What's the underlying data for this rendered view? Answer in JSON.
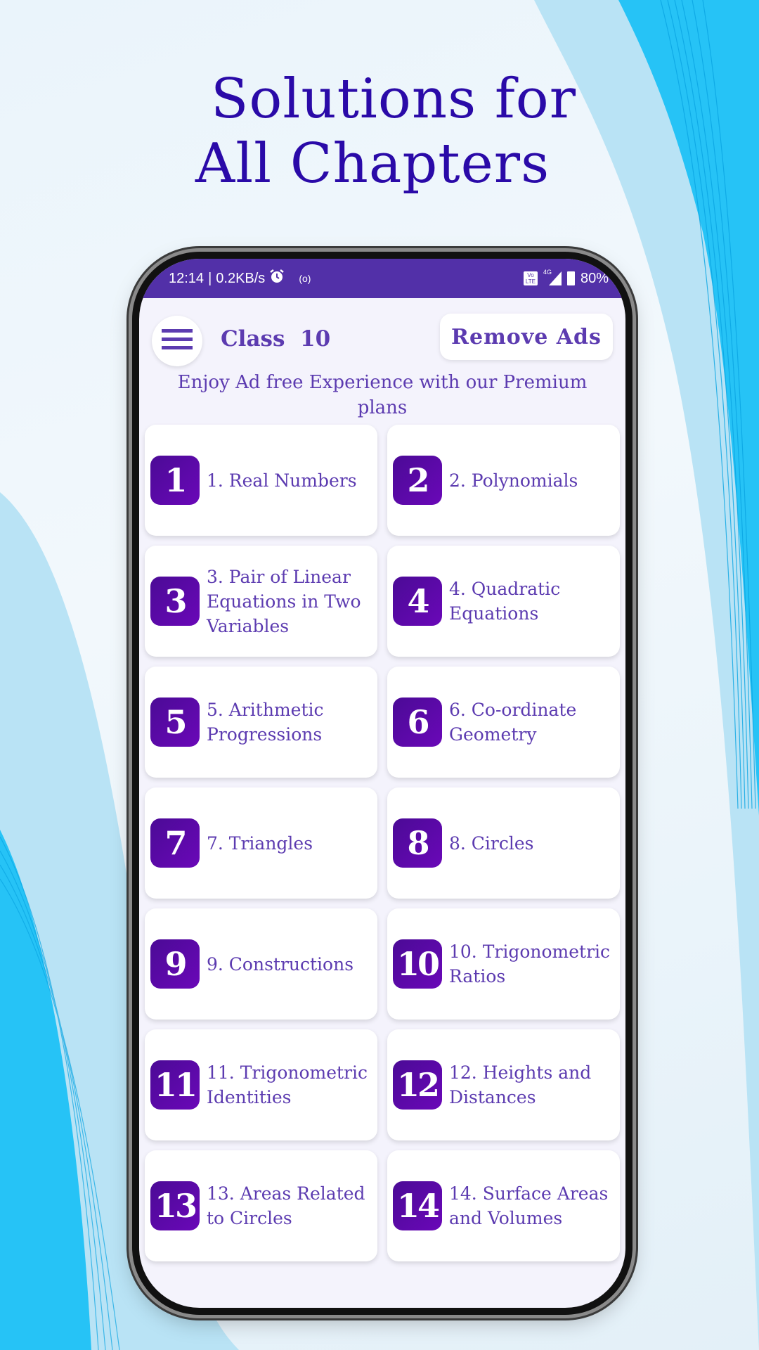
{
  "headline": {
    "line1": "Solutions for",
    "line2": "All Chapters"
  },
  "status_bar": {
    "time": "12:14",
    "separator": "|",
    "speed": "0.2KB/s",
    "icons": [
      "alarm-icon",
      "hotspot-icon",
      "volte-icon",
      "signal-4g-icon",
      "battery-icon"
    ],
    "network": "4G",
    "volte": "Vo LTE",
    "battery": "80%"
  },
  "app": {
    "class_label": "Class  10",
    "remove_ads_label": "Remove Ads",
    "promo_text": "Enjoy Ad free Experience with our Premium plans",
    "menu_icon": "hamburger-menu-icon"
  },
  "chapters": [
    {
      "number": "1",
      "title": "1. Real Numbers"
    },
    {
      "number": "2",
      "title": "2. Polynomials"
    },
    {
      "number": "3",
      "title": "3. Pair of Linear Equations in Two Variables"
    },
    {
      "number": "4",
      "title": "4. Quadratic Equations"
    },
    {
      "number": "5",
      "title": "5. Arithmetic Progressions"
    },
    {
      "number": "6",
      "title": "6. Co-ordinate Geometry"
    },
    {
      "number": "7",
      "title": "7. Triangles"
    },
    {
      "number": "8",
      "title": "8. Circles"
    },
    {
      "number": "9",
      "title": "9. Constructions"
    },
    {
      "number": "10",
      "title": "10. Trigonometric Ratios"
    },
    {
      "number": "11",
      "title": "11. Trigonometric Identities"
    },
    {
      "number": "12",
      "title": "12. Heights and Distances"
    },
    {
      "number": "13",
      "title": "13. Areas Related to Circles"
    },
    {
      "number": "14",
      "title": "14. Surface Areas and Volumes"
    }
  ],
  "colors": {
    "headline": "#2a0aa8",
    "status_bar": "#5230a8",
    "accent_text": "#5c3bb0",
    "badge_start": "#4b0a96",
    "badge_end": "#6a08b8",
    "wave": "#1bbcf5"
  }
}
